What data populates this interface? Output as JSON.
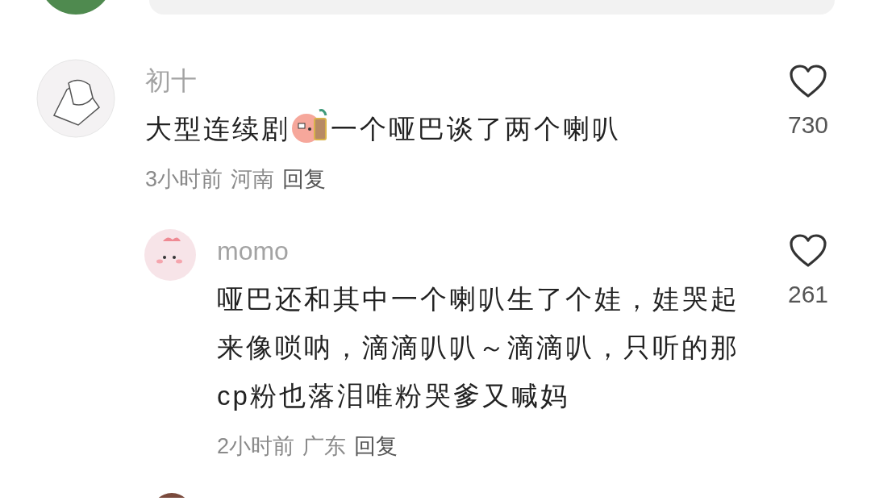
{
  "comments": [
    {
      "user": "初十",
      "content": [
        {
          "kind": "text",
          "text": "大型连续剧"
        },
        {
          "kind": "emoji"
        },
        {
          "kind": "text",
          "text": "一个哑巴谈了两个喇叭"
        }
      ],
      "time": "3小时前",
      "location": "河南",
      "reply": "回复",
      "likes": "730",
      "replies": [
        {
          "user": "momo",
          "content": [
            {
              "kind": "text",
              "text": "哑巴还和其中一个喇叭生了个娃，娃哭起来像唢呐，滴滴叭叭～滴滴叭，只听的那cp粉也落泪唯粉哭爹又喊妈"
            }
          ],
          "time": "2小时前",
          "location": "广东",
          "reply": "回复",
          "likes": "261"
        }
      ]
    }
  ]
}
